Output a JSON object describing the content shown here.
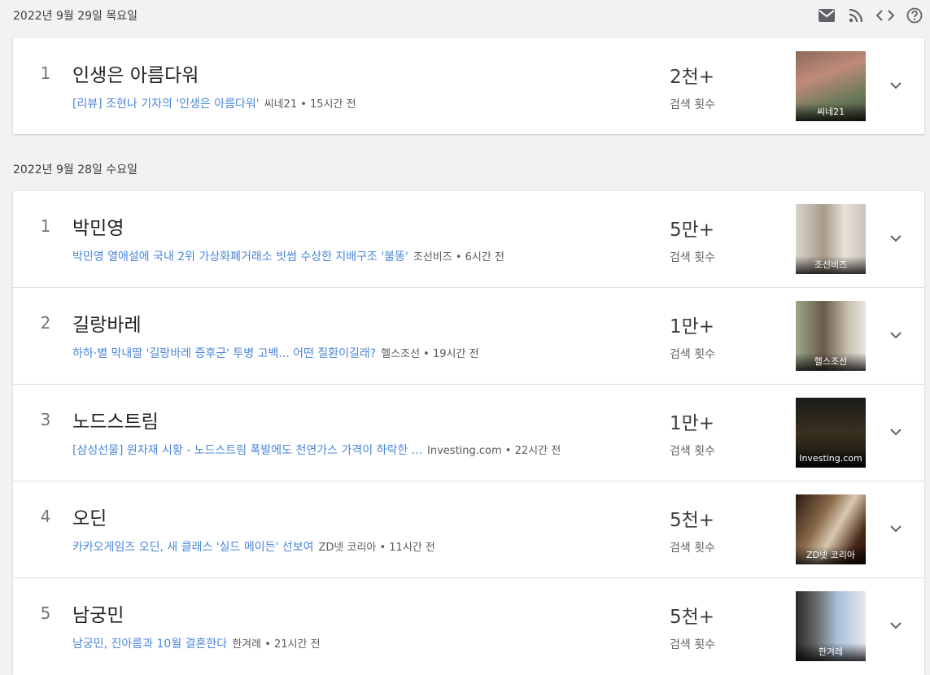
{
  "toolbar": {
    "icons": [
      "mail-icon",
      "rss-icon",
      "embed-code-icon",
      "help-icon"
    ]
  },
  "groups": [
    {
      "date": "2022년 9월 29일 목요일",
      "items": [
        {
          "rank": "1",
          "query": "인생은 아름다워",
          "article": "[리뷰] 조현나 기자의 '인생은 아름다워'",
          "source": "씨네21 • 15시간 전",
          "count": "2천+",
          "count_label": "검색 횟수",
          "thumb_caption": "씨네21"
        }
      ]
    },
    {
      "date": "2022년 9월 28일 수요일",
      "items": [
        {
          "rank": "1",
          "query": "박민영",
          "article": "박민영 열애설에 국내 2위 가상화폐거래소 빗썸 수상한 지배구조 '불똥'",
          "source": "조선비즈 • 6시간 전",
          "count": "5만+",
          "count_label": "검색 횟수",
          "thumb_caption": "조선비즈"
        },
        {
          "rank": "2",
          "query": "길랑바레",
          "article": "하하·별 막내딸 '길랑바레 증후군' 투병 고백... 어떤 질환이길래?",
          "source": "헬스조선 • 19시간 전",
          "count": "1만+",
          "count_label": "검색 횟수",
          "thumb_caption": "헬스조선"
        },
        {
          "rank": "3",
          "query": "노드스트림",
          "article": "[삼성선물] 원자재 시황 - 노드스트림 폭발에도 천연가스 가격이 하락한 ...",
          "source": "Investing.com • 22시간 전",
          "count": "1만+",
          "count_label": "검색 횟수",
          "thumb_caption": "Investing.com"
        },
        {
          "rank": "4",
          "query": "오딘",
          "article": "카카오게임즈 오딘, 새 클래스 '실드 메이든' 선보여",
          "source": "ZD넷 코리아 • 11시간 전",
          "count": "5천+",
          "count_label": "검색 횟수",
          "thumb_caption": "ZD넷 코리아"
        },
        {
          "rank": "5",
          "query": "남궁민",
          "article": "남궁민, 진아름과 10월 결혼한다",
          "source": "한겨레 • 21시간 전",
          "count": "5천+",
          "count_label": "검색 횟수",
          "thumb_caption": "한겨레"
        }
      ]
    }
  ]
}
